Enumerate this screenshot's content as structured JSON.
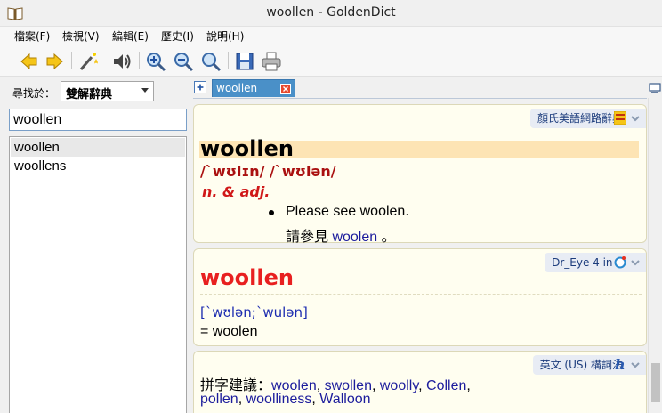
{
  "window": {
    "title": "woollen - GoldenDict"
  },
  "menu": {
    "items": [
      {
        "label": "檔案(F)"
      },
      {
        "label": "檢視(V)"
      },
      {
        "label": "編輯(E)"
      },
      {
        "label": "歷史(I)"
      },
      {
        "label": "說明(H)"
      }
    ]
  },
  "toolbar": {
    "buttons": [
      "back-arrow-icon",
      "forward-arrow-icon",
      "magic-wand-icon",
      "speaker-icon",
      "zoom-in-icon",
      "zoom-out-icon",
      "zoom-reset-icon",
      "save-icon",
      "print-icon"
    ]
  },
  "sidebar": {
    "lookin_label": "尋找於：",
    "dict_group": "雙解辭典",
    "search_value": "woollen",
    "words": [
      {
        "label": "woollen",
        "selected": true
      },
      {
        "label": "woollens",
        "selected": false
      }
    ]
  },
  "tabs": [
    {
      "label": "woollen",
      "active": true
    }
  ],
  "articles": {
    "a1": {
      "dict_name": "顏氏美語網路辭典",
      "headword": "woollen",
      "pron": "/ˋwʊlɪn/ /ˋwʊlən/",
      "pos": "n. & adj.",
      "def_en": "Please see woolen.",
      "def_zh_prefix": "請參見 ",
      "def_zh_link": "woolen",
      "def_zh_suffix": " 。"
    },
    "a2": {
      "dict_name": "Dr_Eye 4 in 1",
      "headword": "woollen",
      "pron": "[ˋwʊlən;ˋwulən]",
      "equiv": "= woolen"
    },
    "a3": {
      "dict_name": "英文 (US) 構詞法",
      "suggest_label": "拼字建議：",
      "suggestions_line1": [
        "woolen",
        "swollen",
        "woolly",
        "Collen"
      ],
      "suggestions_line2": [
        "pollen",
        "woolliness",
        "Walloon"
      ]
    }
  },
  "colors": {
    "accent": "#4a90c8",
    "headword_red": "#e82020",
    "link": "#1c1c9c"
  },
  "scroll": {
    "position_fraction": 0.88
  }
}
